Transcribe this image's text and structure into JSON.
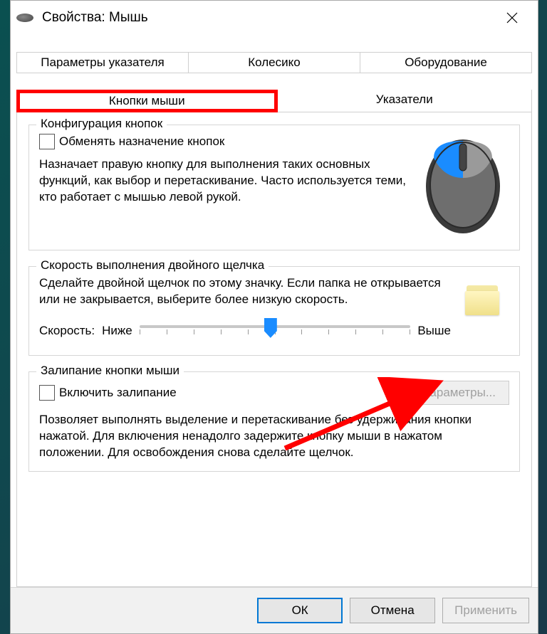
{
  "window": {
    "title": "Свойства: Мышь"
  },
  "tabs": {
    "row1": [
      "Параметры указателя",
      "Колесико",
      "Оборудование"
    ],
    "row2": [
      "Кнопки мыши",
      "Указатели"
    ],
    "active": "Кнопки мыши"
  },
  "group1": {
    "title": "Конфигурация кнопок",
    "checkbox_label": "Обменять назначение кнопок",
    "desc": "Назначает правую кнопку для выполнения таких основных функций, как выбор и перетаскивание. Часто используется теми, кто работает с мышью левой рукой."
  },
  "group2": {
    "title": "Скорость выполнения двойного щелчка",
    "desc": "Сделайте двойной щелчок по этому значку. Если папка не открывается или не закрывается, выберите более низкую скорость.",
    "speed_label": "Скорость:",
    "low": "Ниже",
    "high": "Выше"
  },
  "group3": {
    "title": "Залипание кнопки мыши",
    "checkbox_label": "Включить залипание",
    "params_btn": "Параметры...",
    "desc": "Позволяет выполнять выделение и перетаскивание без удерживания кнопки нажатой. Для включения ненадолго задержите кнопку мыши в нажатом положении. Для освобождения снова сделайте щелчок."
  },
  "buttons": {
    "ok": "ОК",
    "cancel": "Отмена",
    "apply": "Применить"
  }
}
